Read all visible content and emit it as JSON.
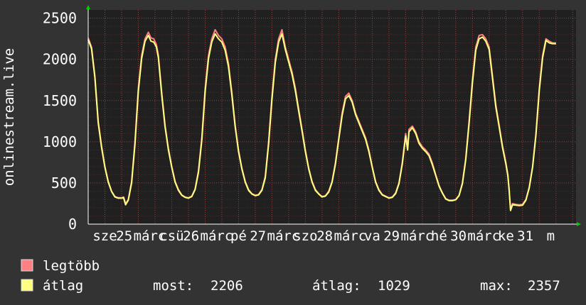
{
  "chart_data": {
    "type": "line",
    "ylabel": "onlinestream.live",
    "ylim": [
      0,
      2600
    ],
    "y_ticks": [
      0,
      500,
      1000,
      1500,
      2000,
      2500
    ],
    "x_range": [
      0,
      7.3
    ],
    "x_tick_labels": [
      {
        "x": 0.25,
        "label": "sze"
      },
      {
        "x": 0.54,
        "label": "25"
      },
      {
        "x": 0.92,
        "label": "márc"
      },
      {
        "x": 1.25,
        "label": "csü"
      },
      {
        "x": 1.54,
        "label": "26"
      },
      {
        "x": 1.92,
        "label": "márc"
      },
      {
        "x": 2.25,
        "label": "pé"
      },
      {
        "x": 2.54,
        "label": "27"
      },
      {
        "x": 2.92,
        "label": "márc"
      },
      {
        "x": 3.25,
        "label": "szo"
      },
      {
        "x": 3.54,
        "label": "28"
      },
      {
        "x": 3.92,
        "label": "márc"
      },
      {
        "x": 4.25,
        "label": "va"
      },
      {
        "x": 4.54,
        "label": "29"
      },
      {
        "x": 4.92,
        "label": "márc"
      },
      {
        "x": 5.25,
        "label": "hé"
      },
      {
        "x": 5.54,
        "label": "30"
      },
      {
        "x": 5.92,
        "label": "márc"
      },
      {
        "x": 6.25,
        "label": "ke"
      },
      {
        "x": 6.54,
        "label": "31"
      },
      {
        "x": 6.92,
        "label": "m"
      }
    ],
    "grid": true,
    "legend_placement": "bottom-left",
    "series": [
      {
        "name": "legtöbb",
        "color": "#ff8080",
        "points": [
          [
            0.0,
            2260
          ],
          [
            0.05,
            2150
          ],
          [
            0.1,
            1800
          ],
          [
            0.15,
            1250
          ],
          [
            0.2,
            950
          ],
          [
            0.25,
            700
          ],
          [
            0.3,
            520
          ],
          [
            0.35,
            400
          ],
          [
            0.4,
            335
          ],
          [
            0.45,
            320
          ],
          [
            0.5,
            320
          ],
          [
            0.53,
            330
          ],
          [
            0.56,
            250
          ],
          [
            0.6,
            300
          ],
          [
            0.65,
            520
          ],
          [
            0.7,
            1000
          ],
          [
            0.75,
            1650
          ],
          [
            0.8,
            2050
          ],
          [
            0.85,
            2250
          ],
          [
            0.9,
            2330
          ],
          [
            0.94,
            2260
          ],
          [
            0.98,
            2250
          ],
          [
            1.02,
            2180
          ],
          [
            1.05,
            2050
          ],
          [
            1.1,
            1600
          ],
          [
            1.15,
            1200
          ],
          [
            1.2,
            920
          ],
          [
            1.25,
            700
          ],
          [
            1.3,
            520
          ],
          [
            1.35,
            420
          ],
          [
            1.4,
            355
          ],
          [
            1.45,
            330
          ],
          [
            1.5,
            320
          ],
          [
            1.55,
            340
          ],
          [
            1.6,
            430
          ],
          [
            1.65,
            650
          ],
          [
            1.7,
            1050
          ],
          [
            1.75,
            1650
          ],
          [
            1.8,
            2050
          ],
          [
            1.85,
            2250
          ],
          [
            1.9,
            2360
          ],
          [
            1.95,
            2290
          ],
          [
            2.0,
            2250
          ],
          [
            2.05,
            2150
          ],
          [
            2.1,
            1950
          ],
          [
            2.15,
            1600
          ],
          [
            2.2,
            1200
          ],
          [
            2.25,
            900
          ],
          [
            2.3,
            680
          ],
          [
            2.35,
            520
          ],
          [
            2.4,
            420
          ],
          [
            2.45,
            370
          ],
          [
            2.5,
            350
          ],
          [
            2.55,
            360
          ],
          [
            2.6,
            420
          ],
          [
            2.65,
            580
          ],
          [
            2.7,
            1000
          ],
          [
            2.75,
            1550
          ],
          [
            2.8,
            2000
          ],
          [
            2.85,
            2250
          ],
          [
            2.9,
            2360
          ],
          [
            2.95,
            2150
          ],
          [
            3.0,
            2000
          ],
          [
            3.05,
            1850
          ],
          [
            3.1,
            1650
          ],
          [
            3.15,
            1400
          ],
          [
            3.2,
            1150
          ],
          [
            3.25,
            900
          ],
          [
            3.3,
            680
          ],
          [
            3.35,
            520
          ],
          [
            3.4,
            420
          ],
          [
            3.45,
            370
          ],
          [
            3.5,
            335
          ],
          [
            3.55,
            345
          ],
          [
            3.6,
            400
          ],
          [
            3.65,
            520
          ],
          [
            3.7,
            750
          ],
          [
            3.75,
            1050
          ],
          [
            3.8,
            1350
          ],
          [
            3.85,
            1550
          ],
          [
            3.9,
            1590
          ],
          [
            3.95,
            1500
          ],
          [
            4.0,
            1350
          ],
          [
            4.05,
            1250
          ],
          [
            4.1,
            1150
          ],
          [
            4.15,
            1050
          ],
          [
            4.2,
            900
          ],
          [
            4.25,
            700
          ],
          [
            4.3,
            520
          ],
          [
            4.35,
            420
          ],
          [
            4.4,
            360
          ],
          [
            4.45,
            340
          ],
          [
            4.5,
            320
          ],
          [
            4.55,
            330
          ],
          [
            4.6,
            380
          ],
          [
            4.65,
            500
          ],
          [
            4.7,
            750
          ],
          [
            4.75,
            1100
          ],
          [
            4.78,
            930
          ],
          [
            4.8,
            1150
          ],
          [
            4.85,
            1190
          ],
          [
            4.9,
            1120
          ],
          [
            4.95,
            1000
          ],
          [
            5.0,
            940
          ],
          [
            5.05,
            900
          ],
          [
            5.1,
            850
          ],
          [
            5.15,
            740
          ],
          [
            5.2,
            600
          ],
          [
            5.25,
            470
          ],
          [
            5.3,
            380
          ],
          [
            5.35,
            310
          ],
          [
            5.4,
            290
          ],
          [
            5.45,
            290
          ],
          [
            5.5,
            300
          ],
          [
            5.55,
            350
          ],
          [
            5.6,
            500
          ],
          [
            5.65,
            800
          ],
          [
            5.7,
            1250
          ],
          [
            5.75,
            1750
          ],
          [
            5.8,
            2150
          ],
          [
            5.85,
            2290
          ],
          [
            5.9,
            2300
          ],
          [
            5.95,
            2250
          ],
          [
            6.0,
            2150
          ],
          [
            6.05,
            1800
          ],
          [
            6.1,
            1450
          ],
          [
            6.15,
            1200
          ],
          [
            6.2,
            950
          ],
          [
            6.25,
            750
          ],
          [
            6.28,
            600
          ],
          [
            6.3,
            420
          ],
          [
            6.32,
            180
          ],
          [
            6.35,
            250
          ],
          [
            6.4,
            240
          ],
          [
            6.45,
            235
          ],
          [
            6.5,
            240
          ],
          [
            6.55,
            300
          ],
          [
            6.6,
            450
          ],
          [
            6.65,
            700
          ],
          [
            6.7,
            1100
          ],
          [
            6.75,
            1650
          ],
          [
            6.8,
            2050
          ],
          [
            6.85,
            2250
          ],
          [
            6.9,
            2220
          ],
          [
            6.95,
            2200
          ],
          [
            7.0,
            2200
          ]
        ]
      },
      {
        "name": "átlag",
        "color": "#ffff80",
        "points": [
          [
            0.0,
            2240
          ],
          [
            0.05,
            2130
          ],
          [
            0.1,
            1780
          ],
          [
            0.15,
            1230
          ],
          [
            0.2,
            930
          ],
          [
            0.25,
            690
          ],
          [
            0.3,
            510
          ],
          [
            0.35,
            395
          ],
          [
            0.4,
            330
          ],
          [
            0.45,
            315
          ],
          [
            0.5,
            315
          ],
          [
            0.53,
            320
          ],
          [
            0.56,
            235
          ],
          [
            0.6,
            290
          ],
          [
            0.65,
            500
          ],
          [
            0.7,
            970
          ],
          [
            0.75,
            1610
          ],
          [
            0.8,
            2010
          ],
          [
            0.85,
            2220
          ],
          [
            0.9,
            2290
          ],
          [
            0.94,
            2220
          ],
          [
            0.98,
            2210
          ],
          [
            1.02,
            2150
          ],
          [
            1.05,
            2020
          ],
          [
            1.1,
            1570
          ],
          [
            1.15,
            1180
          ],
          [
            1.2,
            900
          ],
          [
            1.25,
            690
          ],
          [
            1.3,
            510
          ],
          [
            1.35,
            410
          ],
          [
            1.4,
            350
          ],
          [
            1.45,
            325
          ],
          [
            1.5,
            315
          ],
          [
            1.55,
            335
          ],
          [
            1.6,
            420
          ],
          [
            1.65,
            630
          ],
          [
            1.7,
            1020
          ],
          [
            1.75,
            1610
          ],
          [
            1.8,
            2010
          ],
          [
            1.85,
            2210
          ],
          [
            1.9,
            2310
          ],
          [
            1.95,
            2250
          ],
          [
            2.0,
            2210
          ],
          [
            2.05,
            2110
          ],
          [
            2.1,
            1910
          ],
          [
            2.15,
            1570
          ],
          [
            2.2,
            1180
          ],
          [
            2.25,
            880
          ],
          [
            2.3,
            670
          ],
          [
            2.35,
            510
          ],
          [
            2.4,
            410
          ],
          [
            2.45,
            365
          ],
          [
            2.5,
            345
          ],
          [
            2.55,
            355
          ],
          [
            2.6,
            410
          ],
          [
            2.65,
            560
          ],
          [
            2.7,
            970
          ],
          [
            2.75,
            1510
          ],
          [
            2.8,
            1960
          ],
          [
            2.85,
            2210
          ],
          [
            2.9,
            2310
          ],
          [
            2.95,
            2120
          ],
          [
            3.0,
            1970
          ],
          [
            3.05,
            1820
          ],
          [
            3.1,
            1620
          ],
          [
            3.15,
            1370
          ],
          [
            3.2,
            1130
          ],
          [
            3.25,
            880
          ],
          [
            3.3,
            670
          ],
          [
            3.35,
            510
          ],
          [
            3.4,
            410
          ],
          [
            3.45,
            365
          ],
          [
            3.5,
            330
          ],
          [
            3.55,
            340
          ],
          [
            3.6,
            390
          ],
          [
            3.65,
            510
          ],
          [
            3.7,
            730
          ],
          [
            3.75,
            1030
          ],
          [
            3.8,
            1320
          ],
          [
            3.85,
            1520
          ],
          [
            3.9,
            1560
          ],
          [
            3.95,
            1480
          ],
          [
            4.0,
            1330
          ],
          [
            4.05,
            1230
          ],
          [
            4.1,
            1130
          ],
          [
            4.15,
            1030
          ],
          [
            4.2,
            880
          ],
          [
            4.25,
            690
          ],
          [
            4.3,
            510
          ],
          [
            4.35,
            410
          ],
          [
            4.4,
            355
          ],
          [
            4.45,
            335
          ],
          [
            4.5,
            315
          ],
          [
            4.55,
            325
          ],
          [
            4.6,
            370
          ],
          [
            4.65,
            490
          ],
          [
            4.7,
            730
          ],
          [
            4.75,
            1070
          ],
          [
            4.78,
            900
          ],
          [
            4.8,
            1120
          ],
          [
            4.85,
            1170
          ],
          [
            4.9,
            1100
          ],
          [
            4.95,
            980
          ],
          [
            5.0,
            920
          ],
          [
            5.05,
            880
          ],
          [
            5.1,
            830
          ],
          [
            5.15,
            720
          ],
          [
            5.2,
            590
          ],
          [
            5.25,
            460
          ],
          [
            5.3,
            375
          ],
          [
            5.35,
            305
          ],
          [
            5.4,
            285
          ],
          [
            5.45,
            285
          ],
          [
            5.5,
            295
          ],
          [
            5.55,
            345
          ],
          [
            5.6,
            490
          ],
          [
            5.65,
            780
          ],
          [
            5.7,
            1220
          ],
          [
            5.75,
            1710
          ],
          [
            5.8,
            2110
          ],
          [
            5.85,
            2250
          ],
          [
            5.9,
            2270
          ],
          [
            5.95,
            2220
          ],
          [
            6.0,
            2120
          ],
          [
            6.05,
            1770
          ],
          [
            6.1,
            1420
          ],
          [
            6.15,
            1180
          ],
          [
            6.2,
            930
          ],
          [
            6.25,
            730
          ],
          [
            6.28,
            590
          ],
          [
            6.3,
            400
          ],
          [
            6.32,
            165
          ],
          [
            6.35,
            235
          ],
          [
            6.4,
            230
          ],
          [
            6.45,
            225
          ],
          [
            6.5,
            230
          ],
          [
            6.55,
            290
          ],
          [
            6.6,
            440
          ],
          [
            6.65,
            690
          ],
          [
            6.7,
            1080
          ],
          [
            6.75,
            1620
          ],
          [
            6.8,
            2020
          ],
          [
            6.85,
            2230
          ],
          [
            6.9,
            2200
          ],
          [
            6.95,
            2190
          ],
          [
            7.0,
            2190
          ]
        ]
      }
    ]
  },
  "legend": {
    "items": [
      {
        "label": "legtöbb",
        "color": "#ff8080"
      },
      {
        "label": "átlag",
        "color": "#ffff80"
      }
    ],
    "stats": {
      "now_label": "most:",
      "now_value": "2206",
      "avg_label": "átlag:",
      "avg_value": "1029",
      "max_label": "max:",
      "max_value": "2357"
    }
  },
  "colors": {
    "background": "#333333",
    "plot_background": "#202020",
    "grid": "#7a3030",
    "axis": "#ffffff",
    "arrow": "#00cc00",
    "text": "#ffffff"
  }
}
